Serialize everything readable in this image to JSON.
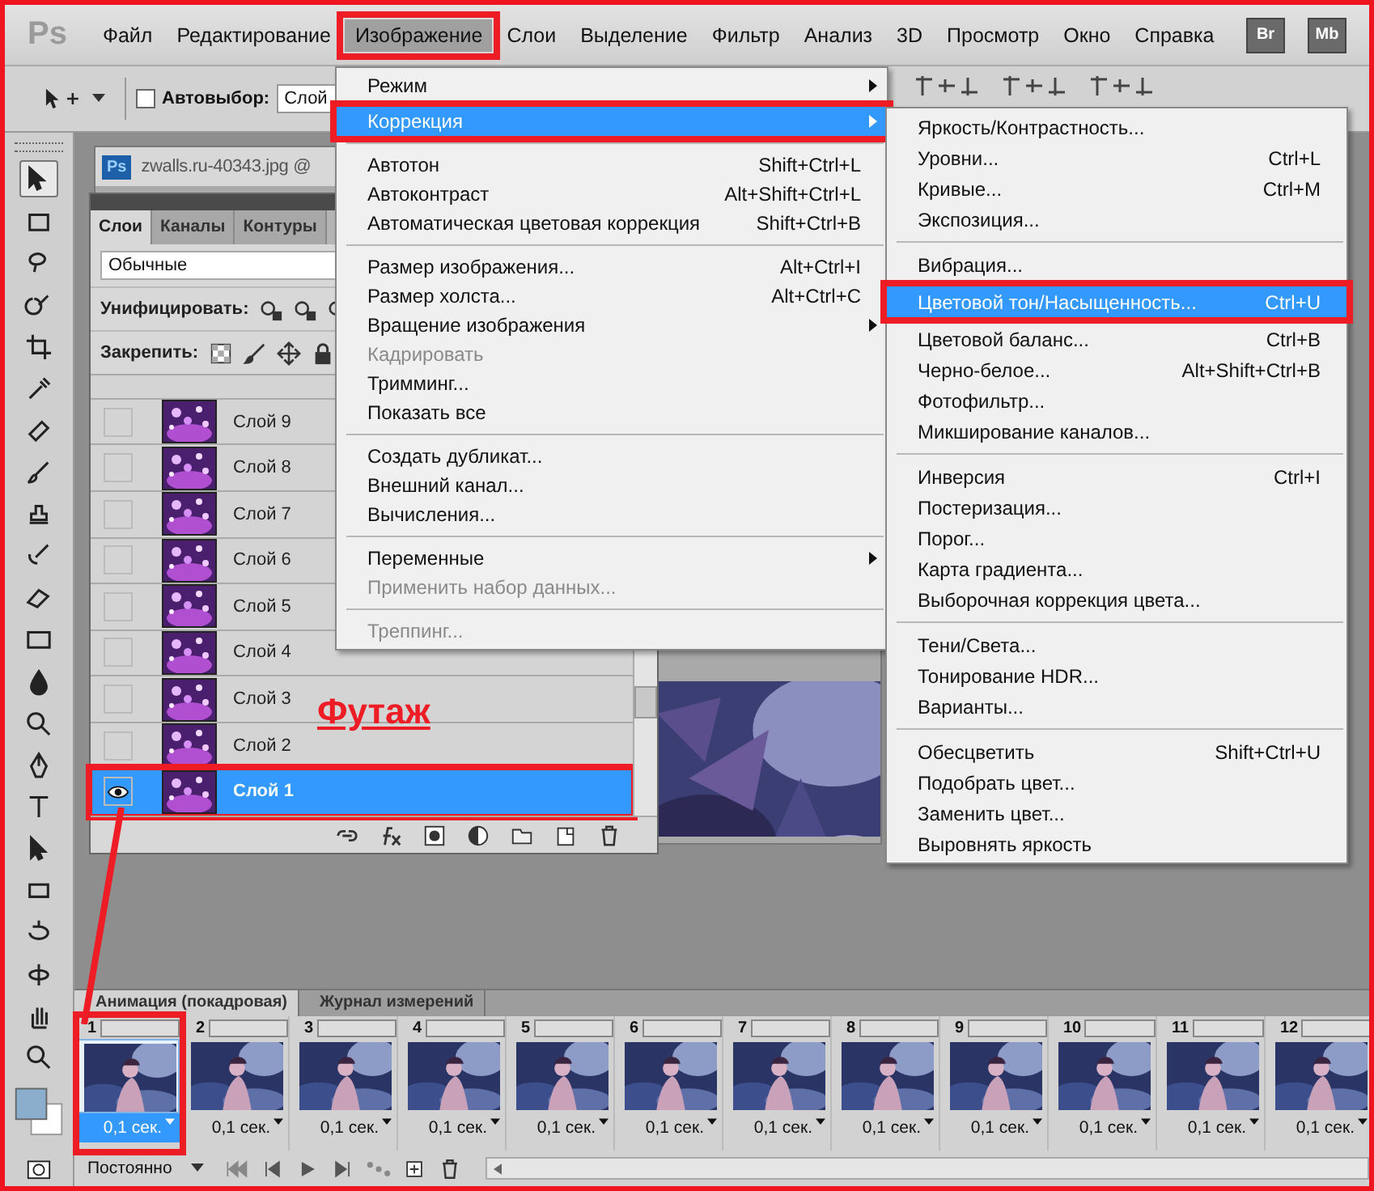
{
  "menubar": {
    "logo": "Ps",
    "items": [
      {
        "label": "Файл",
        "selected": false
      },
      {
        "label": "Редактирование",
        "selected": false
      },
      {
        "label": "Изображение",
        "selected": true
      },
      {
        "label": "Слои",
        "selected": false
      },
      {
        "label": "Выделение",
        "selected": false
      },
      {
        "label": "Фильтр",
        "selected": false
      },
      {
        "label": "Анализ",
        "selected": false
      },
      {
        "label": "3D",
        "selected": false
      },
      {
        "label": "Просмотр",
        "selected": false
      },
      {
        "label": "Окно",
        "selected": false
      },
      {
        "label": "Справка",
        "selected": false
      }
    ],
    "buttons": [
      "Br",
      "Mb"
    ]
  },
  "options_bar": {
    "auto_select": {
      "label": "Автовыбор:",
      "checked": false
    },
    "target": "Слой"
  },
  "document": {
    "icon": "Ps",
    "title": "zwalls.ru-40343.jpg @"
  },
  "layers_panel": {
    "tabs": [
      {
        "label": "Слои",
        "selected": true
      },
      {
        "label": "Каналы",
        "selected": false
      },
      {
        "label": "Контуры",
        "selected": false
      }
    ],
    "blend_mode": "Обычные",
    "unify_label": "Унифицировать:",
    "lock_label": "Закрепить:",
    "layers": [
      {
        "name": "Слой 9",
        "visible": false,
        "selected": false
      },
      {
        "name": "Слой 8",
        "visible": false,
        "selected": false
      },
      {
        "name": "Слой 7",
        "visible": false,
        "selected": false
      },
      {
        "name": "Слой 6",
        "visible": false,
        "selected": false
      },
      {
        "name": "Слой 5",
        "visible": false,
        "selected": false
      },
      {
        "name": "Слой 4",
        "visible": false,
        "selected": false
      },
      {
        "name": "Слой 3",
        "visible": false,
        "selected": false
      },
      {
        "name": "Слой 2",
        "visible": false,
        "selected": false
      },
      {
        "name": "Слой 1",
        "visible": true,
        "selected": true
      }
    ]
  },
  "annotation": {
    "label": "Футаж"
  },
  "image_menu": {
    "items": [
      {
        "kind": "item",
        "label": "Режим",
        "submenu": true,
        "selected": false,
        "disabled": false
      },
      {
        "kind": "item",
        "label": "Коррекция",
        "submenu": true,
        "selected": true,
        "disabled": false
      },
      {
        "kind": "separator"
      },
      {
        "kind": "item",
        "label": "Автотон",
        "shortcut": "Shift+Ctrl+L",
        "submenu": false,
        "selected": false,
        "disabled": false
      },
      {
        "kind": "item",
        "label": "Автоконтраст",
        "shortcut": "Alt+Shift+Ctrl+L",
        "submenu": false,
        "selected": false,
        "disabled": false
      },
      {
        "kind": "item",
        "label": "Автоматическая цветовая коррекция",
        "shortcut": "Shift+Ctrl+B",
        "submenu": false,
        "selected": false,
        "disabled": false
      },
      {
        "kind": "separator"
      },
      {
        "kind": "item",
        "label": "Размер изображения...",
        "shortcut": "Alt+Ctrl+I",
        "submenu": false,
        "selected": false,
        "disabled": false
      },
      {
        "kind": "item",
        "label": "Размер холста...",
        "shortcut": "Alt+Ctrl+C",
        "submenu": false,
        "selected": false,
        "disabled": false
      },
      {
        "kind": "item",
        "label": "Вращение изображения",
        "submenu": true,
        "selected": false,
        "disabled": false
      },
      {
        "kind": "item",
        "label": "Кадрировать",
        "submenu": false,
        "selected": false,
        "disabled": true
      },
      {
        "kind": "item",
        "label": "Тримминг...",
        "submenu": false,
        "selected": false,
        "disabled": false
      },
      {
        "kind": "item",
        "label": "Показать все",
        "submenu": false,
        "selected": false,
        "disabled": false
      },
      {
        "kind": "separator"
      },
      {
        "kind": "item",
        "label": "Создать дубликат...",
        "submenu": false,
        "selected": false,
        "disabled": false
      },
      {
        "kind": "item",
        "label": "Внешний канал...",
        "submenu": false,
        "selected": false,
        "disabled": false
      },
      {
        "kind": "item",
        "label": "Вычисления...",
        "submenu": false,
        "selected": false,
        "disabled": false
      },
      {
        "kind": "separator"
      },
      {
        "kind": "item",
        "label": "Переменные",
        "submenu": true,
        "selected": false,
        "disabled": false
      },
      {
        "kind": "item",
        "label": "Применить набор данных...",
        "submenu": false,
        "selected": false,
        "disabled": true
      },
      {
        "kind": "separator"
      },
      {
        "kind": "item",
        "label": "Треппинг...",
        "submenu": false,
        "selected": false,
        "disabled": true
      }
    ]
  },
  "adjustments_menu": {
    "items": [
      {
        "kind": "item",
        "label": "Яркость/Контрастность...",
        "selected": false
      },
      {
        "kind": "item",
        "label": "Уровни...",
        "shortcut": "Ctrl+L",
        "selected": false
      },
      {
        "kind": "item",
        "label": "Кривые...",
        "shortcut": "Ctrl+M",
        "selected": false
      },
      {
        "kind": "item",
        "label": "Экспозиция...",
        "selected": false
      },
      {
        "kind": "separator"
      },
      {
        "kind": "item",
        "label": "Вибрация...",
        "selected": false
      },
      {
        "kind": "item",
        "label": "Цветовой тон/Насыщенность...",
        "shortcut": "Ctrl+U",
        "selected": true
      },
      {
        "kind": "item",
        "label": "Цветовой баланс...",
        "shortcut": "Ctrl+B",
        "selected": false
      },
      {
        "kind": "item",
        "label": "Черно-белое...",
        "shortcut": "Alt+Shift+Ctrl+B",
        "selected": false
      },
      {
        "kind": "item",
        "label": "Фотофильтр...",
        "selected": false
      },
      {
        "kind": "item",
        "label": "Микширование каналов...",
        "selected": false
      },
      {
        "kind": "separator"
      },
      {
        "kind": "item",
        "label": "Инверсия",
        "shortcut": "Ctrl+I",
        "selected": false
      },
      {
        "kind": "item",
        "label": "Постеризация...",
        "selected": false
      },
      {
        "kind": "item",
        "label": "Порог...",
        "selected": false
      },
      {
        "kind": "item",
        "label": "Карта градиента...",
        "selected": false
      },
      {
        "kind": "item",
        "label": "Выборочная коррекция цвета...",
        "selected": false
      },
      {
        "kind": "separator"
      },
      {
        "kind": "item",
        "label": "Тени/Света...",
        "selected": false
      },
      {
        "kind": "item",
        "label": "Тонирование HDR...",
        "selected": false
      },
      {
        "kind": "item",
        "label": "Варианты...",
        "selected": false
      },
      {
        "kind": "separator"
      },
      {
        "kind": "item",
        "label": "Обесцветить",
        "shortcut": "Shift+Ctrl+U",
        "selected": false
      },
      {
        "kind": "item",
        "label": "Подобрать цвет...",
        "selected": false
      },
      {
        "kind": "item",
        "label": "Заменить цвет...",
        "selected": false
      },
      {
        "kind": "item",
        "label": "Выровнять яркость",
        "selected": false
      }
    ]
  },
  "animation_panel": {
    "tabs": [
      {
        "label": "Анимация (покадровая)",
        "selected": true
      },
      {
        "label": "Журнал измерений",
        "selected": false
      }
    ],
    "frames": [
      {
        "number": "1",
        "delay": "0,1 сек.",
        "selected": true
      },
      {
        "number": "2",
        "delay": "0,1 сек.",
        "selected": false
      },
      {
        "number": "3",
        "delay": "0,1 сек.",
        "selected": false
      },
      {
        "number": "4",
        "delay": "0,1 сек.",
        "selected": false
      },
      {
        "number": "5",
        "delay": "0,1 сек.",
        "selected": false
      },
      {
        "number": "6",
        "delay": "0,1 сек.",
        "selected": false
      },
      {
        "number": "7",
        "delay": "0,1 сек.",
        "selected": false
      },
      {
        "number": "8",
        "delay": "0,1 сек.",
        "selected": false
      },
      {
        "number": "9",
        "delay": "0,1 сек.",
        "selected": false
      },
      {
        "number": "10",
        "delay": "0,1 сек.",
        "selected": false
      },
      {
        "number": "11",
        "delay": "0,1 сек.",
        "selected": false
      },
      {
        "number": "12",
        "delay": "0,1 сек.",
        "selected": false
      }
    ],
    "loop": "Постоянно"
  }
}
